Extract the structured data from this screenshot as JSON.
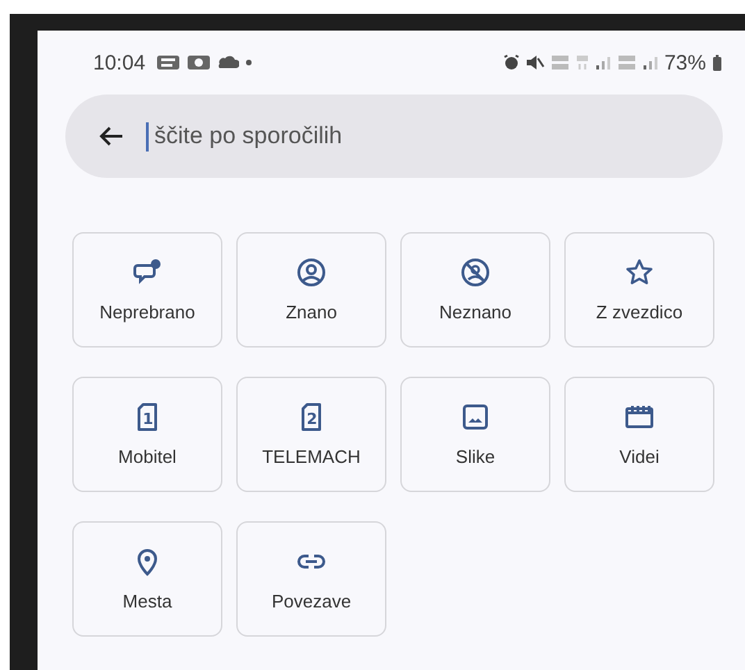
{
  "status_bar": {
    "time": "10:04",
    "battery": "73%"
  },
  "search": {
    "placeholder": "ščite po sporočilih",
    "focused": true
  },
  "filters": [
    {
      "kind": "unread",
      "label": "Neprebrano"
    },
    {
      "kind": "known",
      "label": "Znano"
    },
    {
      "kind": "unknown",
      "label": "Neznano"
    },
    {
      "kind": "starred",
      "label": "Z zvezdico"
    },
    {
      "kind": "sim",
      "badge": "1",
      "label": "Mobitel"
    },
    {
      "kind": "sim",
      "badge": "2",
      "label": "TELEMACH"
    },
    {
      "kind": "images",
      "label": "Slike"
    },
    {
      "kind": "videos",
      "label": "Videi"
    },
    {
      "kind": "places",
      "label": "Mesta"
    },
    {
      "kind": "links",
      "label": "Povezave"
    }
  ]
}
